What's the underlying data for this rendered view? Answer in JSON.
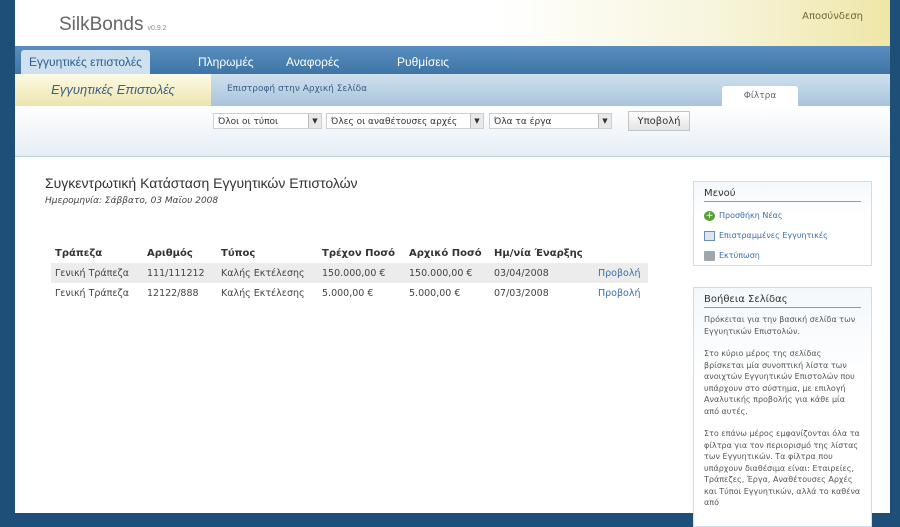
{
  "header": {
    "app_name": "SilkBonds",
    "version": "v0.9.2",
    "logout_label": "Αποσύνδεση"
  },
  "nav": {
    "tabs": [
      {
        "label": "Εγγυητικές επιστολές",
        "active": true
      },
      {
        "label": "Πληρωμές",
        "active": false
      },
      {
        "label": "Αναφορές",
        "active": false
      },
      {
        "label": "Ρυθμίσεις",
        "active": false
      }
    ]
  },
  "subbar": {
    "title": "Εγγυητικές Επιστολές",
    "home_link": "Επιστροφή στην Αρχική Σελίδα",
    "filter_tab": "Φίλτρα"
  },
  "filters": {
    "type_select": "Όλοι οι τύποι",
    "authority_select": "Όλες οι αναθέτουσες αρχές",
    "project_select": "Όλα τα έργα",
    "submit_label": "Υποβολή"
  },
  "main": {
    "title": "Συγκεντρωτική Κατάσταση Εγγυητικών Επιστολών",
    "date_line": "Ημερομηνία: Σάββατο, 03 Μαϊου 2008",
    "table": {
      "headers": [
        "Τράπεζα",
        "Αριθμός",
        "Τύπος",
        "Τρέχον Ποσό",
        "Αρχικό Ποσό",
        "Ημ/νία Έναρξης"
      ],
      "rows": [
        [
          "Γενική Τράπεζα",
          "111/111212",
          "Καλής Εκτέλεσης",
          "150.000,00 €",
          "150.000,00 €",
          "03/04/2008",
          "Προβολή"
        ],
        [
          "Γενική Τράπεζα",
          "12122/888",
          "Καλής Εκτέλεσης",
          "5.000,00 €",
          "5.000,00 €",
          "07/03/2008",
          "Προβολή"
        ]
      ]
    }
  },
  "sidebar": {
    "menu_title": "Μενού",
    "menu_items": [
      "Προσθήκη Νέας",
      "Επιστραμμένες Εγγυητικές",
      "Εκτύπωση"
    ],
    "help_title": "Βοήθεια Σελίδας",
    "help_paragraphs": [
      "Πρόκειται για την βασική σελίδα των Εγγυητικών Επιστολών.",
      "Στο κύριο μέρος της σελίδας βρίσκεται μία συνοπτική λίστα των ανοιχτών Εγγυητικών Επιστολών που υπάρχουν στο σύστημα, με επιλογή Αναλυτικής προβολής για κάθε μία από αυτές.",
      "Στο επάνω μέρος εμφανίζονται όλα τα φίλτρα για τον περιορισμό της λίστας των Εγγυητικών. Τα φίλτρα που υπάρχουν διαθέσιμα είναι: Εταιρείες, Τράπεζες, Έργα, Αναθέτουσες Αρχές και Τύποι Εγγυητικών, αλλά το καθένα από"
    ]
  }
}
